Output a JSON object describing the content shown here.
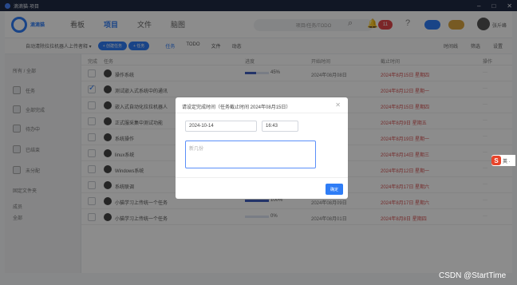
{
  "window": {
    "title": "滴滴猫·项目",
    "minimize": "–",
    "maximize": "□",
    "close": "✕"
  },
  "header": {
    "logo_text": "滴滴猫",
    "nav": [
      "看板",
      "项目",
      "文件",
      "脑图"
    ],
    "search_placeholder": "项目/任务/TODO",
    "badge_count": "11",
    "user": "张斤峰"
  },
  "toolbar": {
    "project": "自动清除拉拉机器人上传者释 ▾",
    "add_task": "+ 创建任务",
    "filter": "+ 任务",
    "tabs": [
      "任务",
      "TODO",
      "文件",
      "动态"
    ],
    "right": [
      "时间线",
      "筛选",
      "设置"
    ]
  },
  "sidebar": {
    "section": "所有 / 全部",
    "items": [
      "任务",
      "全部完成",
      "待办中",
      "已结束",
      "未分配"
    ],
    "group": "固定文件夹",
    "sub1": "成员",
    "sub2": "全部"
  },
  "table": {
    "headers": [
      "完成",
      "任务",
      "进度",
      "开始时间",
      "截止时间",
      "操作"
    ],
    "rows": [
      {
        "name": "操作系统",
        "pct": "45%",
        "progress": 0.45,
        "start": "2024年08月08日",
        "deadline": "2024年8月15日 星期四",
        "checked": false
      },
      {
        "name": "测试嵌入式系统中的通讯",
        "pct": "",
        "progress": 0,
        "start": "",
        "deadline": "2024年8月12日 星期一",
        "checked": true
      },
      {
        "name": "嵌入式自动化拉拉机器人",
        "pct": "",
        "progress": 0,
        "start": "",
        "deadline": "2024年8月15日 星期四",
        "checked": false
      },
      {
        "name": "正式服采集中测试功能",
        "pct": "",
        "progress": 0,
        "start": "",
        "deadline": "2024年8月9日 星期五",
        "checked": false
      },
      {
        "name": "系统操作",
        "pct": "",
        "progress": 0,
        "start": "",
        "deadline": "2024年8月19日 星期一",
        "checked": false
      },
      {
        "name": "linux系统",
        "pct": "",
        "progress": 0,
        "start": "",
        "deadline": "2024年8月14日 星期三",
        "checked": false
      },
      {
        "name": "Windows系统",
        "pct": "",
        "progress": 0,
        "start": "",
        "deadline": "2024年8月12日 星期一",
        "checked": false
      },
      {
        "name": "系统联调",
        "pct": "0%",
        "progress": 0,
        "start": "2024年08月13日",
        "deadline": "2024年8月17日 星期六",
        "checked": false
      },
      {
        "name": "小猫学习上传统一个任务",
        "pct": "100%",
        "progress": 1.0,
        "start": "2024年08月09日",
        "deadline": "2024年8月17日 星期六",
        "checked": false
      },
      {
        "name": "小猫学习上传统一个任务",
        "pct": "0%",
        "progress": 0,
        "start": "2024年08月01日",
        "deadline": "2024年8月8日 星期四",
        "checked": false
      }
    ]
  },
  "modal": {
    "title": "请设定完成时间（任务截止时间 2024年08月15日）",
    "date": "2024-10-14",
    "time": "16:43",
    "note_placeholder": "新几份",
    "confirm": "确定"
  },
  "ime": {
    "icon": "S",
    "label": "英 ·"
  },
  "watermark": "CSDN @StartTime"
}
